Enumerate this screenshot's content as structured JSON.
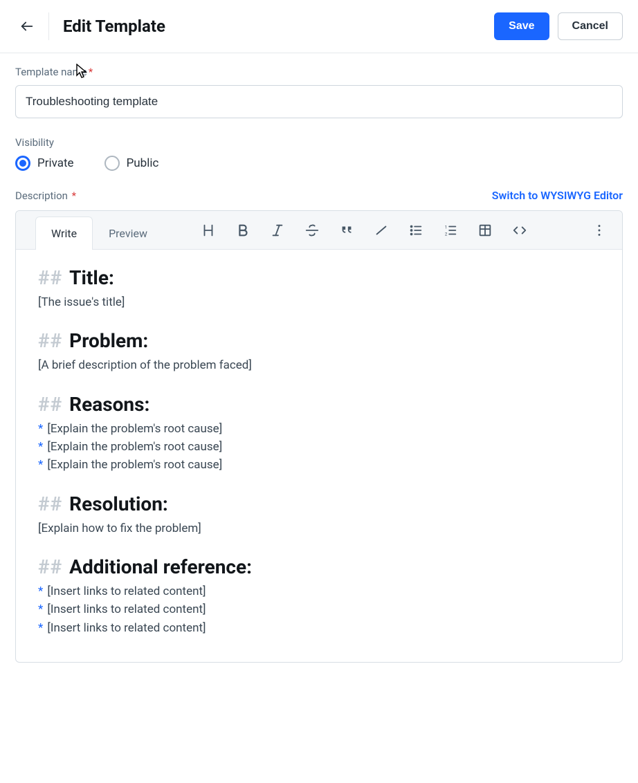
{
  "header": {
    "title": "Edit Template",
    "save_label": "Save",
    "cancel_label": "Cancel"
  },
  "template_name": {
    "label": "Template name",
    "required_mark": "*",
    "value": "Troubleshooting template"
  },
  "visibility": {
    "label": "Visibility",
    "options": {
      "private": "Private",
      "public": "Public"
    },
    "selected": "private"
  },
  "description": {
    "label": "Description",
    "required_mark": "*",
    "switch_link": "Switch to WYSIWYG Editor",
    "tabs": {
      "write": "Write",
      "preview": "Preview"
    }
  },
  "editor_body": {
    "hash": "##",
    "star": "*",
    "sections": {
      "title": {
        "heading": "Title:",
        "line": "[The issue's title]"
      },
      "problem": {
        "heading": "Problem:",
        "line": "[A brief description of the problem faced]"
      },
      "reasons": {
        "heading": "Reasons:",
        "bullets": [
          "[Explain the problem's root cause]",
          "[Explain the problem's root cause]",
          "[Explain the problem's root cause]"
        ]
      },
      "resolution": {
        "heading": "Resolution:",
        "line": "[Explain how to fix the problem]"
      },
      "additional": {
        "heading": "Additional reference:",
        "bullets": [
          "[Insert links to related content]",
          "[Insert links to related content]",
          "[Insert links to related content]"
        ]
      }
    }
  }
}
